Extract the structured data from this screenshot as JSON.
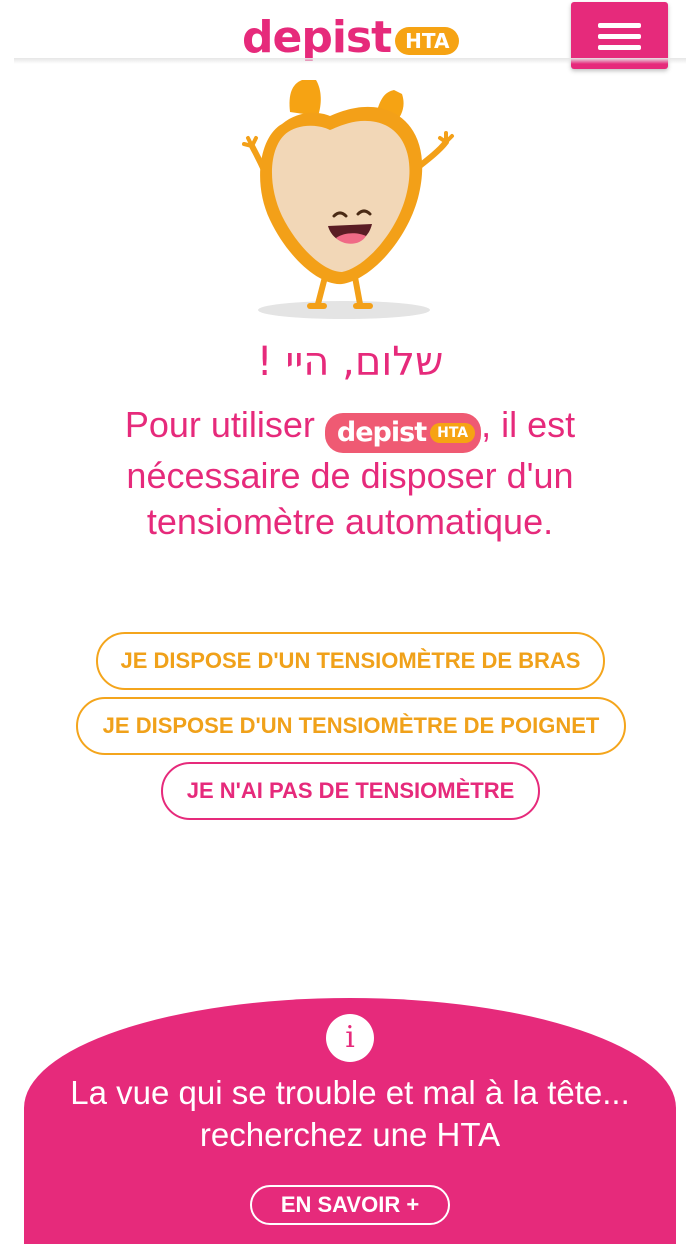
{
  "header": {
    "logo_word": "depist",
    "logo_badge": "HTA",
    "menu_icon": "hamburger-menu-icon"
  },
  "mascot": {
    "icon": "heart-mascot-icon"
  },
  "main": {
    "greeting": "שלום, היי !",
    "intro_before": "Pour utiliser ",
    "intro_logo_word": "depist",
    "intro_logo_badge": "HTA",
    "intro_after": ", il est nécessaire de disposer d'un tensiomètre automatique."
  },
  "choices": [
    {
      "label": "JE DISPOSE D'UN TENSIOMÈTRE DE BRAS",
      "style": "orange"
    },
    {
      "label": "JE DISPOSE D'UN TENSIOMÈTRE DE POIGNET",
      "style": "orange"
    },
    {
      "label": "JE N'AI PAS DE TENSIOMÈTRE",
      "style": "pink"
    }
  ],
  "info": {
    "icon_glyph": "i",
    "line1": "La vue qui se trouble et mal à la tête...",
    "line2": "recherchez une HTA",
    "more_label": "EN SAVOIR +"
  },
  "colors": {
    "brand_pink": "#e62a7b",
    "brand_orange": "#f6a313",
    "inline_logo_bg": "#ef5a73"
  }
}
